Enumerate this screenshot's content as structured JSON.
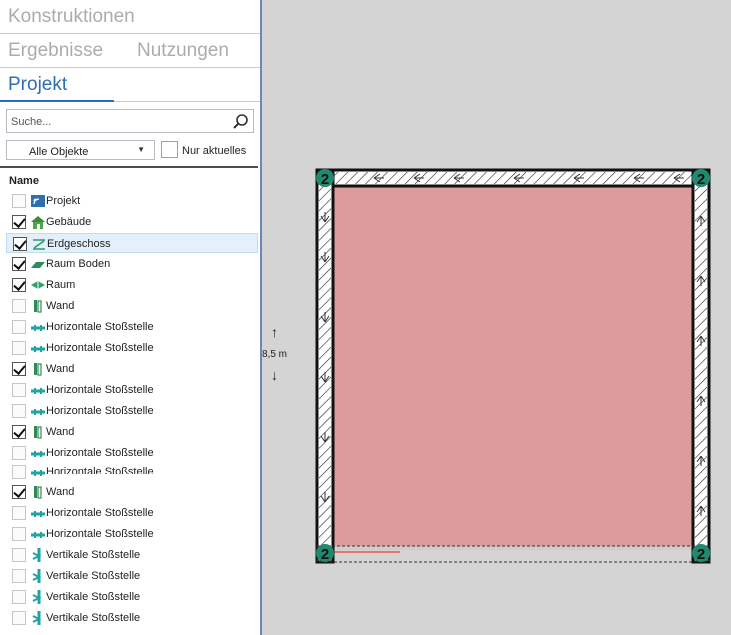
{
  "tabs": {
    "konstruktionen": "Konstruktionen",
    "ergebnisse": "Ergebnisse",
    "nutzungen": "Nutzungen",
    "projekt": "Projekt"
  },
  "search": {
    "placeholder": "Suche..."
  },
  "filter": {
    "selected": "Alle Objekte"
  },
  "only_current": {
    "label": "Nur aktuelles",
    "checked": false
  },
  "list": {
    "header": "Name",
    "items": [
      {
        "label": "Projekt",
        "checked": false,
        "icon": "project-icon"
      },
      {
        "label": "Gebäude",
        "checked": true,
        "icon": "building-icon"
      },
      {
        "label": "Erdgeschoss",
        "checked": true,
        "icon": "floor-icon",
        "selected": true
      },
      {
        "label": "Raum Boden",
        "checked": true,
        "icon": "room-floor-icon"
      },
      {
        "label": "Raum",
        "checked": true,
        "icon": "room-icon"
      },
      {
        "label": "Wand",
        "checked": false,
        "icon": "wall-icon"
      },
      {
        "label": "Horizontale Stoßstelle",
        "checked": false,
        "icon": "horizontal-joint-icon"
      },
      {
        "label": "Horizontale Stoßstelle",
        "checked": false,
        "icon": "horizontal-joint-icon"
      },
      {
        "label": "Wand",
        "checked": true,
        "icon": "wall-icon"
      },
      {
        "label": "Horizontale Stoßstelle",
        "checked": false,
        "icon": "horizontal-joint-icon"
      },
      {
        "label": "Horizontale Stoßstelle",
        "checked": false,
        "icon": "horizontal-joint-icon"
      },
      {
        "label": "Wand",
        "checked": true,
        "icon": "wall-icon"
      },
      {
        "label": "Horizontale Stoßstelle",
        "checked": false,
        "icon": "horizontal-joint-icon"
      },
      {
        "label": "Horizontale Stoßstelle",
        "checked": false,
        "icon": "horizontal-joint-icon"
      },
      {
        "label": "Wand",
        "checked": true,
        "icon": "wall-icon"
      },
      {
        "label": "Horizontale Stoßstelle",
        "checked": false,
        "icon": "horizontal-joint-icon"
      },
      {
        "label": "Horizontale Stoßstelle",
        "checked": false,
        "icon": "horizontal-joint-icon"
      },
      {
        "label": "Vertikale Stoßstelle",
        "checked": false,
        "icon": "vertical-joint-icon"
      },
      {
        "label": "Vertikale Stoßstelle",
        "checked": false,
        "icon": "vertical-joint-icon"
      },
      {
        "label": "Vertikale Stoßstelle",
        "checked": false,
        "icon": "vertical-joint-icon"
      },
      {
        "label": "Vertikale Stoßstelle",
        "checked": false,
        "icon": "vertical-joint-icon"
      }
    ]
  },
  "canvas": {
    "dimension": "8,5 m",
    "node_labels": [
      "2",
      "2",
      "2",
      "2"
    ],
    "room_color": "#dc9c9d",
    "node_color": "#1f8a70"
  }
}
